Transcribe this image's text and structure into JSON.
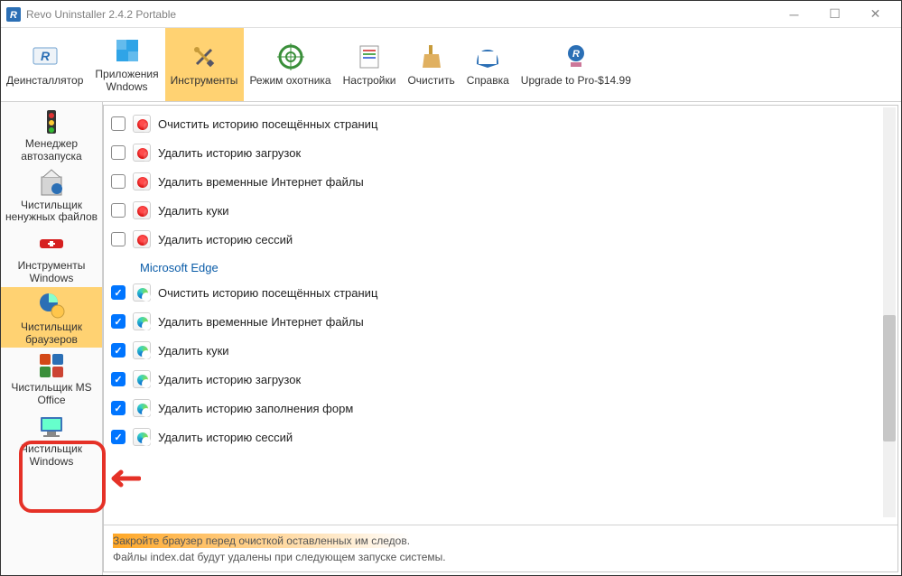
{
  "window": {
    "title": "Revo Uninstaller 2.4.2 Portable"
  },
  "ribbon": [
    {
      "label": "Деинсталлятор",
      "icon": "uninstaller"
    },
    {
      "label": "Приложения\nWndows",
      "icon": "win-apps"
    },
    {
      "label": "Инструменты",
      "icon": "tools",
      "active": true
    },
    {
      "label": "Режим охотника",
      "icon": "hunter"
    },
    {
      "label": "Настройки",
      "icon": "settings"
    },
    {
      "label": "Очистить",
      "icon": "clean"
    },
    {
      "label": "Справка",
      "icon": "help"
    },
    {
      "label": "Upgrade to Pro-$14.99",
      "icon": "upgrade"
    }
  ],
  "sidebar": [
    {
      "label": "Менеджер автозапуска",
      "icon": "autorun"
    },
    {
      "label": "Чистильщик ненужных файлов",
      "icon": "junk"
    },
    {
      "label": "Инструменты Windows",
      "icon": "swiss"
    },
    {
      "label": "Чистильщик браузеров",
      "icon": "browsers",
      "active": true
    },
    {
      "label": "Чистильщик MS Office",
      "icon": "office"
    },
    {
      "label": "Чистильщик Windows",
      "icon": "wincleaner",
      "highlight": true
    }
  ],
  "opera_items": [
    {
      "label": "Очистить историю посещённых страниц",
      "checked": false
    },
    {
      "label": "Удалить историю загрузок",
      "checked": false
    },
    {
      "label": "Удалить временные Интернет файлы",
      "checked": false
    },
    {
      "label": "Удалить куки",
      "checked": false
    },
    {
      "label": "Удалить историю сессий",
      "checked": false
    }
  ],
  "edge_section": "Microsoft Edge",
  "edge_items": [
    {
      "label": "Очистить историю посещённых страниц",
      "checked": true
    },
    {
      "label": "Удалить временные Интернет файлы",
      "checked": true
    },
    {
      "label": "Удалить куки",
      "checked": true
    },
    {
      "label": "Удалить историю загрузок",
      "checked": true
    },
    {
      "label": "Удалить историю заполнения форм",
      "checked": true
    },
    {
      "label": "Удалить историю сессий",
      "checked": true
    }
  ],
  "footer": {
    "line1": "Закройте браузер перед очисткой оставленных им следов.",
    "line2": "Файлы index.dat будут удалены при следующем запуске системы."
  }
}
